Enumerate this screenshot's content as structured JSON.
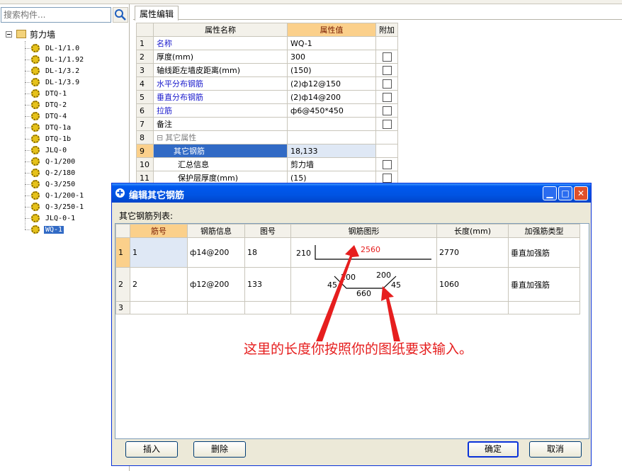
{
  "left_panel": {
    "search_placeholder": "搜索构件...",
    "tree_root": "剪力墙",
    "tree_items": [
      "DL-1/1.0",
      "DL-1/1.92",
      "DL-1/3.2",
      "DL-1/3.9",
      "DTQ-1",
      "DTQ-2",
      "DTQ-4",
      "DTQ-1a",
      "DTQ-1b",
      "JLQ-0",
      "Q-1/200",
      "Q-2/180",
      "Q-3/250",
      "Q-1/200-1",
      "Q-3/250-1",
      "JLQ-0-1",
      "WQ-1"
    ],
    "selected_item": "WQ-1"
  },
  "property_panel": {
    "tab": "属性编辑",
    "headers": {
      "name": "属性名称",
      "value": "属性值",
      "extra": "附加"
    },
    "rows": [
      {
        "num": "1",
        "name": "名称",
        "value": "WQ-1",
        "blue": true,
        "checkbox": false
      },
      {
        "num": "2",
        "name": "厚度(mm)",
        "value": "300",
        "blue": false,
        "checkbox": true
      },
      {
        "num": "3",
        "name": "轴线距左墙皮距离(mm)",
        "value": "(150)",
        "blue": false,
        "checkbox": true
      },
      {
        "num": "4",
        "name": "水平分布钢筋",
        "value": "(2)ф12@150",
        "blue": true,
        "checkbox": true
      },
      {
        "num": "5",
        "name": "垂直分布钢筋",
        "value": "(2)ф14@200",
        "blue": true,
        "checkbox": true
      },
      {
        "num": "6",
        "name": "拉筋",
        "value": "ф6@450*450",
        "blue": true,
        "checkbox": true
      },
      {
        "num": "7",
        "name": "备注",
        "value": "",
        "blue": false,
        "checkbox": true
      },
      {
        "num": "8",
        "name": "其它属性",
        "value": "",
        "blue": false,
        "checkbox": false
      },
      {
        "num": "9",
        "name": "其它钢筋",
        "value": "18,133",
        "blue": false,
        "checkbox": false
      },
      {
        "num": "10",
        "name": "汇总信息",
        "value": "剪力墙",
        "blue": false,
        "checkbox": true
      },
      {
        "num": "11",
        "name": "保护层厚度(mm)",
        "value": "(15)",
        "blue": false,
        "checkbox": true
      }
    ]
  },
  "dialog": {
    "title": "编辑其它钢筋",
    "list_label": "其它钢筋列表:",
    "headers": [
      "筋号",
      "钢筋信息",
      "图号",
      "钢筋图形",
      "长度(mm)",
      "加强筋类型"
    ],
    "rows": [
      {
        "num": "1",
        "bar_no": "1",
        "info": "ф14@200",
        "fig": "18",
        "length": "2770",
        "type": "垂直加强筋",
        "shape": {
          "left_dim": "210",
          "main_dim": "2560"
        }
      },
      {
        "num": "2",
        "bar_no": "2",
        "info": "ф12@200",
        "fig": "133",
        "length": "1060",
        "type": "垂直加强筋",
        "shape": {
          "left_top": "200",
          "right_top": "200",
          "left_angle": "45",
          "right_angle": "45",
          "bottom": "660"
        }
      },
      {
        "num": "3",
        "bar_no": "",
        "info": "",
        "fig": "",
        "length": "",
        "type": "",
        "shape": null
      }
    ],
    "buttons": {
      "insert": "插入",
      "delete": "删除",
      "ok": "确定",
      "cancel": "取消"
    }
  },
  "annotation": {
    "text": "这里的长度你按照你的图纸要求输入。",
    "color": "#e61e1e"
  }
}
